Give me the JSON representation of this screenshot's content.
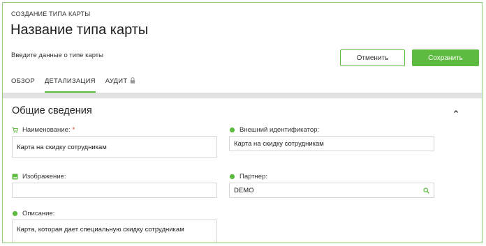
{
  "header": {
    "breadcrumb": "СОЗДАНИЕ ТИПА КАРТЫ",
    "title": "Название типа карты",
    "subtitle": "Введите данные о типе карты",
    "cancel_label": "Отменить",
    "save_label": "Сохранить"
  },
  "tabs": [
    {
      "label": "ОБЗОР",
      "active": false
    },
    {
      "label": "ДЕТАЛИЗАЦИЯ",
      "active": true
    },
    {
      "label": "АУДИТ",
      "active": false,
      "icon": "lock-icon"
    }
  ],
  "section": {
    "title": "Общие сведения",
    "icon": "chevron-up-icon"
  },
  "fields": {
    "name": {
      "label": "Наименование:",
      "required": "*",
      "value": "Карта на скидку сотрудникам",
      "icon": "cart-icon"
    },
    "external_id": {
      "label": "Внешний идентификатор:",
      "value": "Карта на скидку сотрудникам",
      "icon": "info-dot-icon"
    },
    "image": {
      "label": "Изображение:",
      "value": "",
      "icon": "image-icon"
    },
    "partner": {
      "label": "Партнер:",
      "value": "DEMO",
      "icon": "info-dot-icon"
    },
    "description": {
      "label": "Описание:",
      "value": "Карта, которая дает специальную скидку сотрудникам",
      "icon": "info-dot-icon"
    }
  },
  "colors": {
    "accent": "#5dbb3f",
    "required": "#d9322b",
    "frame_border": "#8fd07a"
  }
}
